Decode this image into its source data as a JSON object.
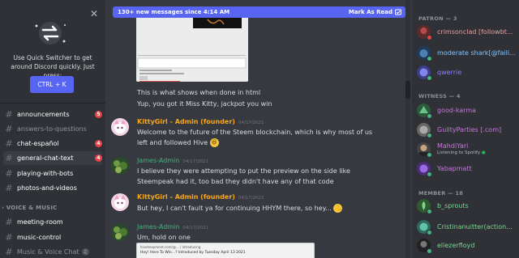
{
  "quick_switcher": {
    "close": "✕",
    "text": "Use Quick Switcher to get around Discord quickly. Just press:",
    "shortcut": "CTRL + K"
  },
  "channels": [
    {
      "name": "announcements",
      "badge": "5"
    },
    {
      "name": "answers-to-questions",
      "badge": ""
    },
    {
      "name": "chat-español",
      "badge": "4"
    },
    {
      "name": "general-chat-text",
      "badge": "4"
    },
    {
      "name": "playing-with-bots",
      "badge": ""
    },
    {
      "name": "photos-and-videos",
      "badge": ""
    }
  ],
  "voice_category": "VOICE & MUSIC",
  "voice_channels": [
    {
      "name": "meeting-room"
    },
    {
      "name": "music-control"
    },
    {
      "name": "Music & Voice Chat"
    }
  ],
  "banner": {
    "text": "130+ new messages since 4:14 AM",
    "action": "Mark As Read"
  },
  "messages": {
    "m1_line1": "This is what shows when done in html",
    "m1_line2": "Yup, you got it Miss Kitty, jackpot you win",
    "m2_author": "KittyGirl - Admin (founder)",
    "m2_time": "04/17/2021",
    "m2_text": "Welcome to the future of the Steem blockchain, which is why most of us left and followed Hive",
    "m3_author": "James-Admin",
    "m3_time": "04/17/2021",
    "m3_text": "I believe they were attempting to put the preview on the side like Steempeak had it, too bad they didn't have any of that code",
    "m4_author": "KittyGirl - Admin (founder)",
    "m4_time": "04/17/2021",
    "m4_text": "But hey, I can't fault ya for continuing HHYM there, so hey...",
    "m5_author": "James-Admin",
    "m5_time": "04/17/2021",
    "m5_text": "Um, hold on one",
    "preview_line1": "hiveheoyment.com/@... / Introducing",
    "preview_line2": "Hey! Here To Win...? Introduced by Tuesday April 13 2021"
  },
  "members": {
    "patron_header": "PATRON — 3",
    "patron": [
      {
        "name": "crimsonclad [followbt..."
      },
      {
        "name": "moderate shark[@faili..."
      },
      {
        "name": "qwerrie"
      }
    ],
    "witness_header": "WITNESS — 4",
    "witness": [
      {
        "name": "good-karma"
      },
      {
        "name": "GuiltyParties [.com]"
      },
      {
        "name": "MahdiYari",
        "status": "Listening to Spotify"
      },
      {
        "name": "Yabapmatt"
      }
    ],
    "member_header": "MEMBER — 18",
    "member": [
      {
        "name": "b_sprouts"
      },
      {
        "name": "Cristinanuitter(action..."
      },
      {
        "name": "eliezerfloyd"
      }
    ]
  },
  "colors": {
    "accent": "#5865f2",
    "author_admin": "#faa61a",
    "author_james": "#43b581"
  }
}
